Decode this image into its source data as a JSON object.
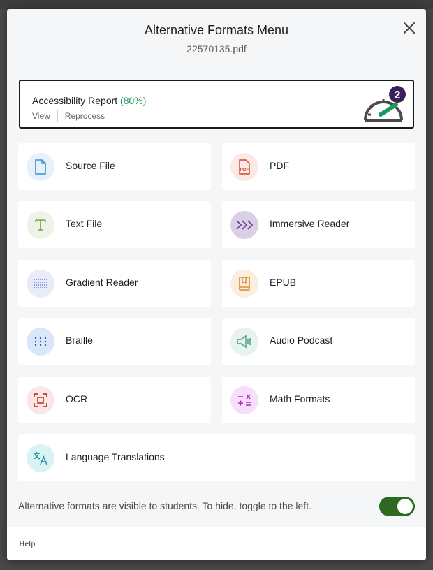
{
  "modal": {
    "title": "Alternative Formats Menu",
    "filename": "22570135.pdf"
  },
  "report": {
    "label": "Accessibility Report",
    "score": "(80%)",
    "view": "View",
    "reprocess": "Reprocess",
    "badge": "2"
  },
  "formats": [
    {
      "label": "Source File",
      "icon": "file-icon",
      "color": "#e8f1fa"
    },
    {
      "label": "PDF",
      "icon": "pdf-icon",
      "color": "#fbe9e3"
    },
    {
      "label": "Text File",
      "icon": "text-t-icon",
      "color": "#eef3e8"
    },
    {
      "label": "Immersive Reader",
      "icon": "chevrons-icon",
      "color": "#d9cfe6"
    },
    {
      "label": "Gradient Reader",
      "icon": "lines-icon",
      "color": "#e8ecf8"
    },
    {
      "label": "EPUB",
      "icon": "book-icon",
      "color": "#fbeede"
    },
    {
      "label": "Braille",
      "icon": "braille-icon",
      "color": "#d9e7f8"
    },
    {
      "label": "Audio Podcast",
      "icon": "speaker-icon",
      "color": "#e6f3ee"
    },
    {
      "label": "OCR",
      "icon": "scan-icon",
      "color": "#fbe7e5"
    },
    {
      "label": "Math Formats",
      "icon": "math-icon",
      "color": "#f7defa"
    },
    {
      "label": "Language Translations",
      "icon": "translate-icon",
      "color": "#d9f3f5"
    }
  ],
  "footer": {
    "note": "Alternative formats are visible to students. To hide, toggle to the left.",
    "toggle_on": true,
    "help": "Help"
  },
  "colors": {
    "accent_green": "#1a9a5a",
    "toggle_on": "#2d6a1f",
    "badge": "#3b1f5a"
  }
}
